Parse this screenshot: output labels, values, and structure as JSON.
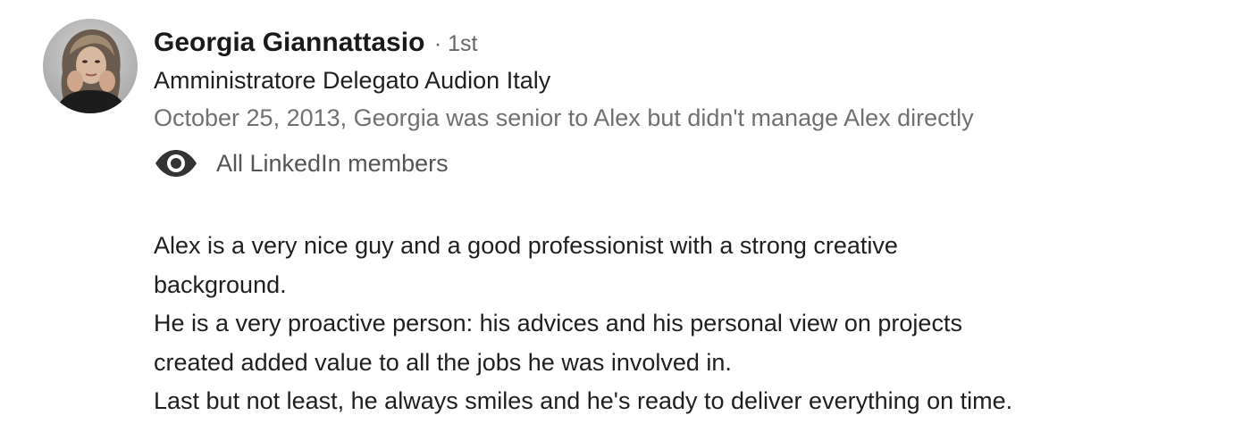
{
  "recommender": {
    "name": "Georgia Giannattasio",
    "degree": "· 1st",
    "title": "Amministratore Delegato Audion Italy",
    "relationship": "October 25, 2013, Georgia was senior to Alex but didn't manage Alex directly",
    "avatar_icon": "profile-photo"
  },
  "visibility": {
    "icon": "eye-icon",
    "label": "All LinkedIn members"
  },
  "recommendation": {
    "lines": [
      "Alex is a very nice guy and a good professionist with a strong creative",
      "background.",
      "He is a very proactive person: his advices and his personal view on projects",
      "created added value to all the jobs he was involved in.",
      "Last but not least, he always smiles and he's ready to deliver everything on time."
    ]
  }
}
